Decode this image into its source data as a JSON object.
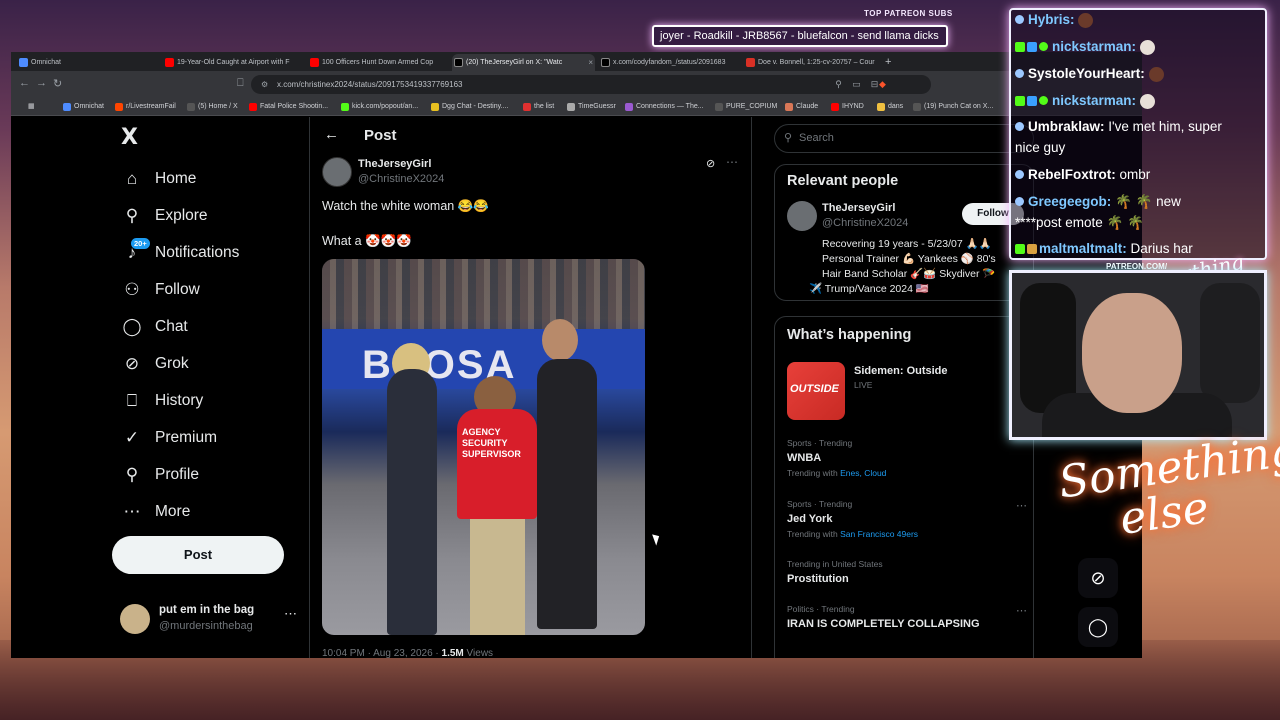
{
  "overlay": {
    "patreon_label": "TOP PATREON SUBS",
    "ticker": "joyer - Roadkill - JRB8567 - bluefalcon - send llama dicks",
    "patreon_url": "PATREON.COM/",
    "script_logo": "Anything Else",
    "neon_line1": "Something",
    "neon_line2": "else"
  },
  "browser": {
    "tabs": [
      {
        "label": "Omnichat",
        "color": "#4e8cff"
      },
      {
        "label": "19-Year-Old Caught at Airport with F",
        "color": "#ff0000"
      },
      {
        "label": "100 Officers Hunt Down Armed Cop",
        "color": "#ff0000"
      },
      {
        "label": "(20) TheJerseyGirl on X: \"Watc",
        "color": "#000000"
      },
      {
        "label": "x.com/codyfandom_/status/2091683",
        "color": "#000000"
      },
      {
        "label": "Doe v. Bonnell, 1:25-cv-20757 – Cour",
        "color": "#d93025"
      }
    ],
    "new_tab": "+",
    "url": "x.com/christinex2024/status/2091753419337769163",
    "bookmarks": [
      {
        "label": "Omnichat",
        "color": "#4e8cff"
      },
      {
        "label": "r/LivestreamFail",
        "color": "#ff4500"
      },
      {
        "label": "(5) Home / X",
        "color": "#000000"
      },
      {
        "label": "Fatal Police Shootin...",
        "color": "#ff0000"
      },
      {
        "label": "kick.com/popout/an...",
        "color": "#53fc18"
      },
      {
        "label": "Dgg Chat - Destiny....",
        "color": "#e8c020"
      },
      {
        "label": "the list",
        "color": "#e03030"
      },
      {
        "label": "TimeGuessr",
        "color": "#aaaaaa"
      },
      {
        "label": "Connections — The...",
        "color": "#9a5ad0"
      },
      {
        "label": "PURE_COPIUM",
        "color": "#000000"
      },
      {
        "label": "Claude",
        "color": "#d97757"
      },
      {
        "label": "IHYND",
        "color": "#ff0000"
      },
      {
        "label": "dans",
        "color": "#f0c040"
      },
      {
        "label": "(19) Punch Cat on X...",
        "color": "#000000"
      }
    ]
  },
  "nav": {
    "logo": "X",
    "items": [
      {
        "label": "Home",
        "icon": "home-icon",
        "glyph": "⌂"
      },
      {
        "label": "Explore",
        "icon": "search-icon",
        "glyph": "⚲"
      },
      {
        "label": "Notifications",
        "icon": "bell-icon",
        "glyph": "♪"
      },
      {
        "label": "Follow",
        "icon": "person-add-icon",
        "glyph": "⚇"
      },
      {
        "label": "Chat",
        "icon": "chat-icon",
        "glyph": "◯"
      },
      {
        "label": "Grok",
        "icon": "grok-icon",
        "glyph": "⊘"
      },
      {
        "label": "History",
        "icon": "bookmark-icon",
        "glyph": "⎕"
      },
      {
        "label": "Premium",
        "icon": "verified-icon",
        "glyph": "✓"
      },
      {
        "label": "Profile",
        "icon": "person-icon",
        "glyph": "⚲"
      },
      {
        "label": "More",
        "icon": "more-circle-icon",
        "glyph": "⋯"
      }
    ],
    "notif_badge": "20+",
    "post_button": "Post",
    "account_name": "put em in the bag",
    "account_handle": "@murdersinthebag"
  },
  "post": {
    "header": "Post",
    "author": "TheJerseyGirl",
    "handle": "@ChristineX2024",
    "text1": "Watch the white woman 😂😂",
    "text2": "What a 🤡🤡🤡",
    "media_banner": "BROSA",
    "shirt_text": "AGENCY\nSECURITY\nSUPERVISOR",
    "timestamp": "10:04 PM · Aug 23, 2026 ·",
    "views_count": "1.5M",
    "views_label": "Views"
  },
  "sidebar": {
    "search_placeholder": "Search",
    "relevant_title": "Relevant people",
    "person_name": "TheJerseyGirl",
    "person_handle": "@ChristineX2024",
    "follow_label": "Follow",
    "bio": [
      "Recovering 19 years - 5/23/07 🙏🏻🙏🏻",
      "Personal Trainer 💪🏻 Yankees ⚾ 80's",
      "Hair Band Scholar 🎸🥁 Skydiver 🪂",
      "✈️ Trump/Vance 2024 🇺🇸"
    ],
    "happening_title": "What’s happening",
    "featured": {
      "thumb": "OUTSIDE",
      "name": "Sidemen: Outside",
      "status": "LIVE"
    },
    "trends": [
      {
        "category": "Sports · Trending",
        "name": "WNBA",
        "with_label": "Trending with",
        "with": "Enes, Cloud"
      },
      {
        "category": "Sports · Trending",
        "name": "Jed York",
        "with_label": "Trending with",
        "with": "San Francisco 49ers"
      },
      {
        "category": "Trending in United States",
        "name": "Prostitution",
        "with_label": "",
        "with": ""
      },
      {
        "category": "Politics · Trending",
        "name": "IRAN IS COMPLETELY COLLAPSING",
        "with_label": "",
        "with": ""
      }
    ]
  },
  "chat": {
    "messages": [
      {
        "user": "Hybris:",
        "text": "",
        "color": "#7fc8ff"
      },
      {
        "user": "nickstarman:",
        "text": "",
        "color": "#7fc8ff"
      },
      {
        "user": "SystoleYourHeart:",
        "text": "",
        "color": "#ffffff"
      },
      {
        "user": "nickstarman:",
        "text": "",
        "color": "#7fc8ff"
      },
      {
        "user": "Umbraklaw:",
        "text": " I've met him, super",
        "color": "#ffffff"
      },
      {
        "user": "",
        "text": "nice guy",
        "color": "#ffffff"
      },
      {
        "user": "RebelFoxtrot:",
        "text": " ombr",
        "color": "#ffffff"
      },
      {
        "user": "Greegeegob:",
        "text": " 🌴 🌴 new",
        "color": "#7fc8ff"
      },
      {
        "user": "",
        "text": "****post emote 🌴 🌴",
        "color": "#ffffff"
      },
      {
        "user": "maltmaltmalt:",
        "text": " Darius har",
        "color": "#7fc8ff"
      }
    ]
  },
  "colors": {
    "accent": "#1d9bf0",
    "post_btn": "#eff3f4",
    "neon": "#ff7a3a"
  }
}
